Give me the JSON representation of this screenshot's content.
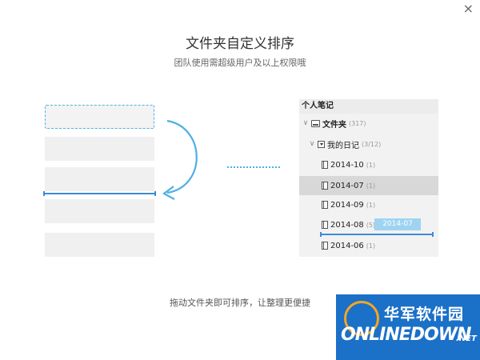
{
  "window": {
    "close_glyph": "×"
  },
  "header": {
    "title": "文件夹自定义排序",
    "subtitle": "团队使用需超级用户及以上权限哦"
  },
  "panel": {
    "header": "个人笔记",
    "rows": [
      {
        "label": "文件夹",
        "count": "(317)",
        "icon": "folder-icon",
        "chevron": "chevron-down-icon"
      },
      {
        "label": "我的日记",
        "count": "(3/12)",
        "icon": "diary-icon",
        "chevron": "chevron-down-icon"
      },
      {
        "label": "2014-10",
        "count": "(1)",
        "icon": "notebook-icon"
      },
      {
        "label": "2014-07",
        "count": "(1)",
        "icon": "notebook-icon",
        "selected": true
      },
      {
        "label": "2014-09",
        "count": "(1)",
        "icon": "notebook-icon"
      },
      {
        "label": "2014-08",
        "count": "(5)",
        "icon": "notebook-icon"
      },
      {
        "label": "2014-06",
        "count": "(1)",
        "icon": "notebook-icon"
      }
    ],
    "drag_badge": "2014-07"
  },
  "footer": {
    "text": "拖动文件夹即可排序，让整理更便捷"
  },
  "watermark": {
    "cn": "华军软件园",
    "en": "ONLINEDOWN",
    "net": ".NET"
  },
  "colors": {
    "accent": "#4fb0e6",
    "insert_line": "#3b8cd8",
    "placeholder": "#f0f0f0",
    "selected_row": "#d8d8d8",
    "watermark_bg": "#1b70c8"
  }
}
